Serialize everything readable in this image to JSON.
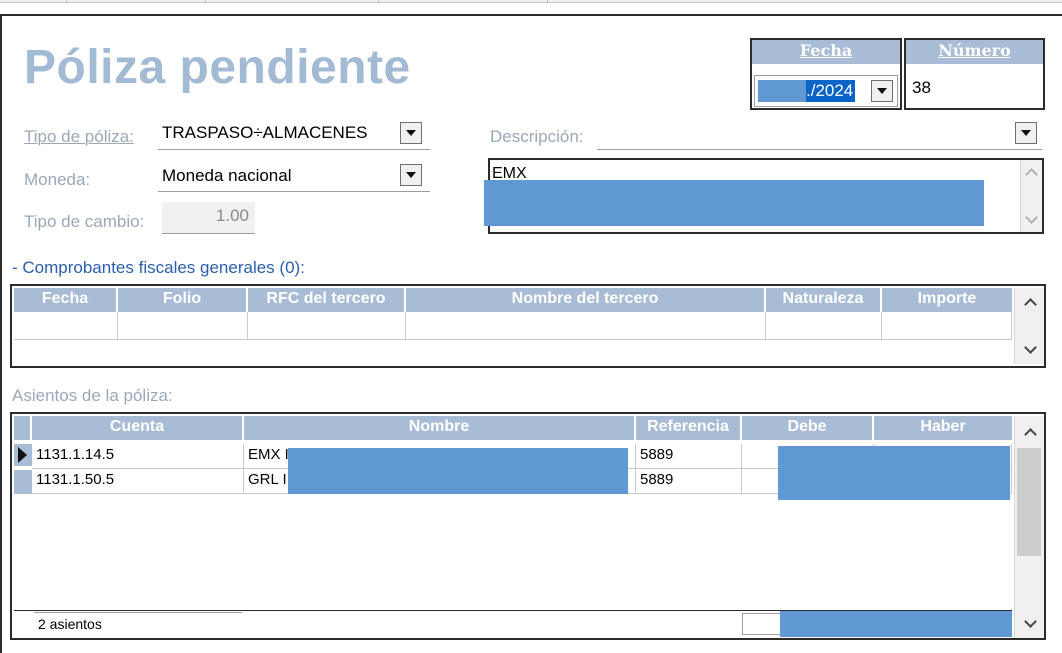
{
  "header": {
    "title": "Póliza pendiente"
  },
  "fecha": {
    "label": "Fecha",
    "value": "./2024"
  },
  "numero": {
    "label": "Número",
    "value": "38"
  },
  "form": {
    "tipo_poliza_label": "Tipo de póliza:",
    "tipo_poliza_value": "TRASPASO÷ALMACENES",
    "moneda_label": "Moneda:",
    "moneda_value": "Moneda nacional",
    "tipo_cambio_label": "Tipo de cambio:",
    "tipo_cambio_value": "1.00",
    "descripcion_label": "Descripción:",
    "descripcion_text": "EMX"
  },
  "comprobantes": {
    "title": "- Comprobantes fiscales generales (0):",
    "columns": [
      "Fecha",
      "Folio",
      "RFC del tercero",
      "Nombre del tercero",
      "Naturaleza",
      "Importe"
    ]
  },
  "asientos": {
    "title": "Asientos de la póliza:",
    "columns": [
      "Cuenta",
      "Nombre",
      "Referencia",
      "Debe",
      "Haber"
    ],
    "rows": [
      {
        "cuenta": "1131.1.14.5",
        "nombre": "EMX I",
        "referencia": "5889"
      },
      {
        "cuenta": "1131.1.50.5",
        "nombre": "GRL I",
        "referencia": "5889"
      }
    ],
    "count_label": "2 asientos"
  }
}
